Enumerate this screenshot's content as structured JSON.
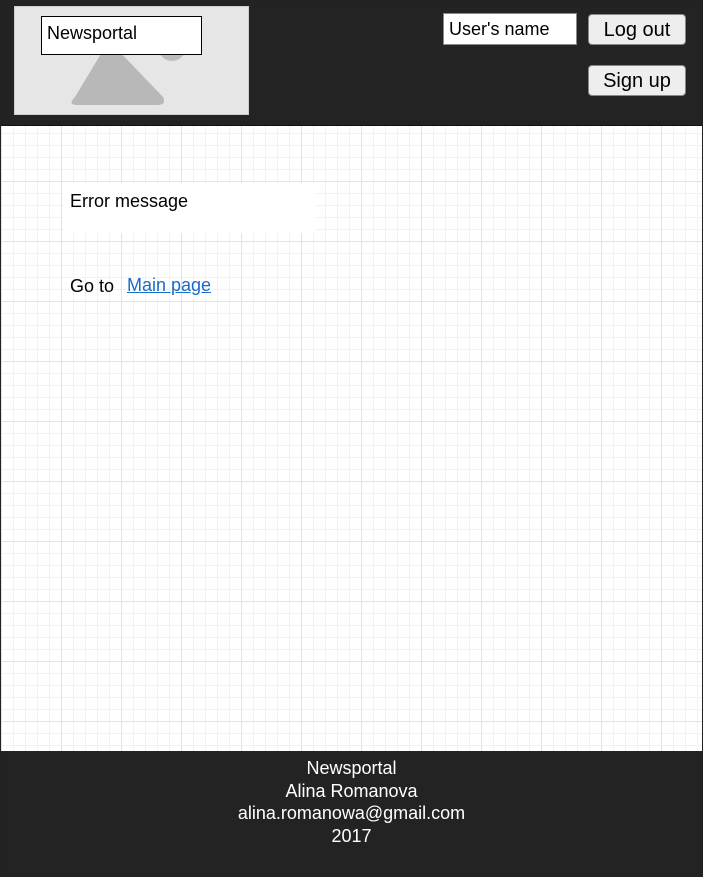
{
  "header": {
    "site_title": "Newsportal",
    "user_name": "User's name",
    "logout_label": "Log out",
    "signup_label": "Sign up"
  },
  "main": {
    "error_message": "Error message",
    "goto_label": "Go to",
    "main_page_link": "Main page"
  },
  "footer": {
    "site_name": "Newsportal",
    "author": "Alina Romanova",
    "email": "alina.romanowa@gmail.com",
    "year": "2017"
  },
  "colors": {
    "header_bg": "#232323",
    "footer_bg": "#232323",
    "link": "#1a6cc7"
  }
}
